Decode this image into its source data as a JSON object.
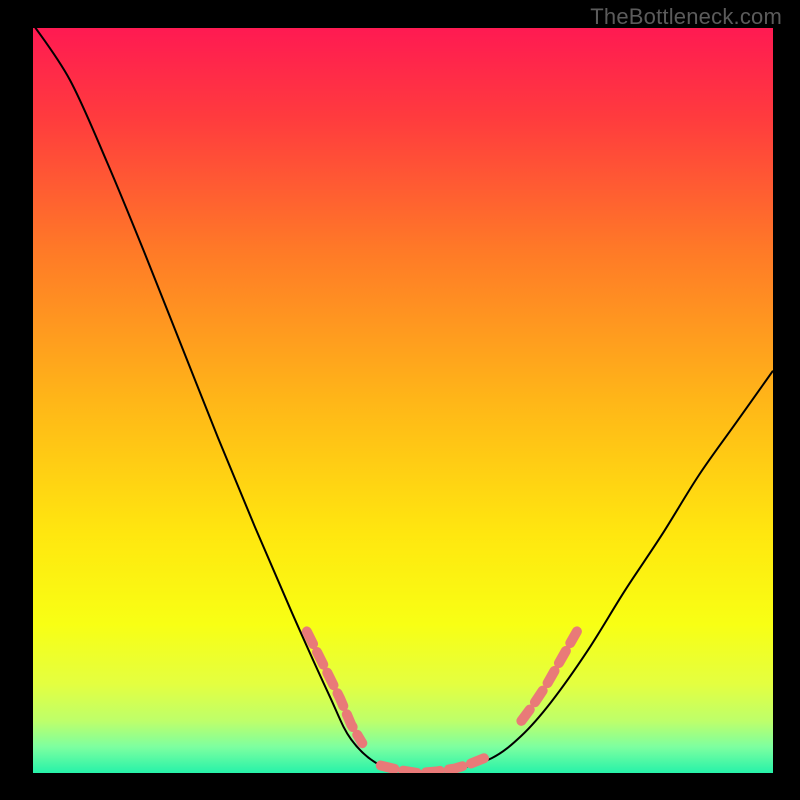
{
  "watermark": "TheBottleneck.com",
  "chart_data": {
    "type": "line",
    "title": "",
    "xlabel": "",
    "ylabel": "",
    "xlim": [
      0,
      1
    ],
    "ylim": [
      0,
      1
    ],
    "background": {
      "type": "vertical-gradient",
      "stops": [
        {
          "pos": 0.0,
          "color": "#ff1a52"
        },
        {
          "pos": 0.12,
          "color": "#ff3b3e"
        },
        {
          "pos": 0.3,
          "color": "#ff7a27"
        },
        {
          "pos": 0.5,
          "color": "#ffb618"
        },
        {
          "pos": 0.68,
          "color": "#ffe70f"
        },
        {
          "pos": 0.8,
          "color": "#f8ff14"
        },
        {
          "pos": 0.88,
          "color": "#e4ff40"
        },
        {
          "pos": 0.93,
          "color": "#beff6a"
        },
        {
          "pos": 0.965,
          "color": "#7dffa0"
        },
        {
          "pos": 1.0,
          "color": "#26f2a9"
        }
      ]
    },
    "series": [
      {
        "name": "bottleneck-curve",
        "color": "#000000",
        "x": [
          0.0,
          0.05,
          0.1,
          0.15,
          0.2,
          0.25,
          0.3,
          0.35,
          0.4,
          0.43,
          0.47,
          0.52,
          0.57,
          0.62,
          0.66,
          0.7,
          0.75,
          0.8,
          0.85,
          0.9,
          0.95,
          1.0
        ],
        "y": [
          1.005,
          0.93,
          0.82,
          0.7,
          0.575,
          0.45,
          0.33,
          0.215,
          0.105,
          0.045,
          0.01,
          0.0,
          0.005,
          0.02,
          0.05,
          0.095,
          0.165,
          0.245,
          0.32,
          0.4,
          0.47,
          0.54
        ]
      },
      {
        "name": "highlight-dots-left",
        "color": "#e97a78",
        "style": "dashed-thick",
        "x": [
          0.37,
          0.38,
          0.4,
          0.415,
          0.43,
          0.445
        ],
        "y": [
          0.19,
          0.17,
          0.13,
          0.1,
          0.065,
          0.04
        ]
      },
      {
        "name": "highlight-dots-bottom",
        "color": "#e97a78",
        "style": "dashed-thick",
        "x": [
          0.47,
          0.495,
          0.52,
          0.545,
          0.57,
          0.59,
          0.61
        ],
        "y": [
          0.01,
          0.004,
          0.0,
          0.002,
          0.006,
          0.012,
          0.02
        ]
      },
      {
        "name": "highlight-dots-right",
        "color": "#e97a78",
        "style": "dashed-thick",
        "x": [
          0.66,
          0.675,
          0.695,
          0.715,
          0.735
        ],
        "y": [
          0.07,
          0.09,
          0.12,
          0.155,
          0.19
        ]
      }
    ]
  }
}
